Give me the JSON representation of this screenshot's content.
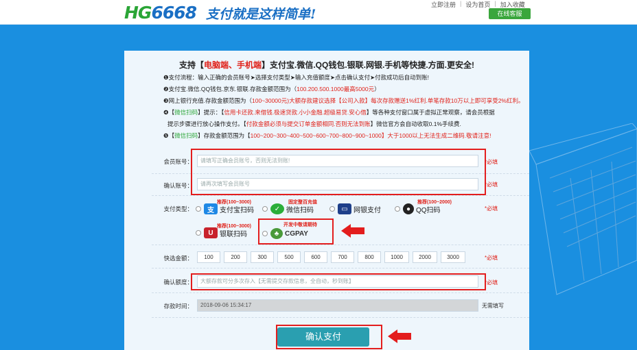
{
  "header": {
    "logo_hg": "HG",
    "logo_num": "6668",
    "slogan": "支付就是这样简单!",
    "links": [
      "立即注册",
      "设为首页",
      "加入收藏"
    ],
    "service_button": "在线客服"
  },
  "headline": {
    "prefix": "支持【",
    "highlight": "电脑端、手机端",
    "suffix": "】支付宝.微信.QQ钱包.银联.网银.手机等快捷.方面.更安全!"
  },
  "info": [
    {
      "a": "❶支付流程：输入正确的会员账号➤选择支付类型➤输入充值额度➤点击确认支付➤付款成功后自动到账!",
      "b": "",
      "c": ""
    },
    {
      "a": "❷支付宝.微信.QQ钱包.京东.银联.存款金额范围为（",
      "b": "100.200.500.1000最高5000元",
      "c": "）"
    },
    {
      "a": "❸网上银行充值.存款金额范围为（",
      "b": "100~30000元)大额存款建议选择【公司入款】每次存款赠送1%红利.单笔存款10万以上即可享受2%红利。",
      "c": ""
    },
    {
      "a": "❹【",
      "g": "微信扫码",
      "a2": "】提示：【",
      "b": "信用卡还款.来借钱.极速贷款.小小金融.超级易贷.安心借",
      "c": "】等各种支付窗口属于虚拟正常观察，请会员根据"
    },
    {
      "a": "提示步骤进行放心操作支付。【",
      "b": "付款金额必须与提交订单金额相同.否则无法到账",
      "c": "】微信官方会自动收取0.1%手续费."
    },
    {
      "a": "❺【",
      "g": "微信扫码",
      "a2": "】存款金额范围为【",
      "b": "100~200~300~400~500~600~700~800~900~1000",
      "c": "】大于1000以上无法生成二维码.敬请注意!"
    }
  ],
  "form": {
    "member_label": "会员账号：",
    "member_placeholder": "请填写正确会员账号，否则无法到账!",
    "confirm_label": "确认账号：",
    "confirm_placeholder": "请再次填写会员账号",
    "required": "*必填",
    "pay_type_label": "支付类型：",
    "pay_types": [
      {
        "name": "支付宝扫码",
        "tag": "推荐(100~3000)"
      },
      {
        "name": "微信扫码",
        "tag": "固定整百充值"
      },
      {
        "name": "网银支付",
        "tag": ""
      },
      {
        "name": "QQ扫码",
        "tag": "推荐(100~2000)"
      },
      {
        "name": "银联扫码",
        "tag": "推荐(100~3000)"
      },
      {
        "name": "CGPAY",
        "tag": "开发中敬请期待"
      }
    ],
    "quick_label": "快选金额：",
    "amounts": [
      "100",
      "200",
      "300",
      "500",
      "600",
      "700",
      "800",
      "1000",
      "2000",
      "3000"
    ],
    "amount_label": "确认额度：",
    "amount_placeholder": "大额存款可分多次存入【无需提交存款信息，全自动，秒到账】",
    "time_label": "存款时间：",
    "time_value": "2018-09-06 15:34:17",
    "time_note": "无需填写",
    "submit": "确认支付"
  },
  "colors": {
    "accent": "#1a8fe0",
    "highlight_red": "#e31d1d",
    "green": "#2aa536"
  }
}
